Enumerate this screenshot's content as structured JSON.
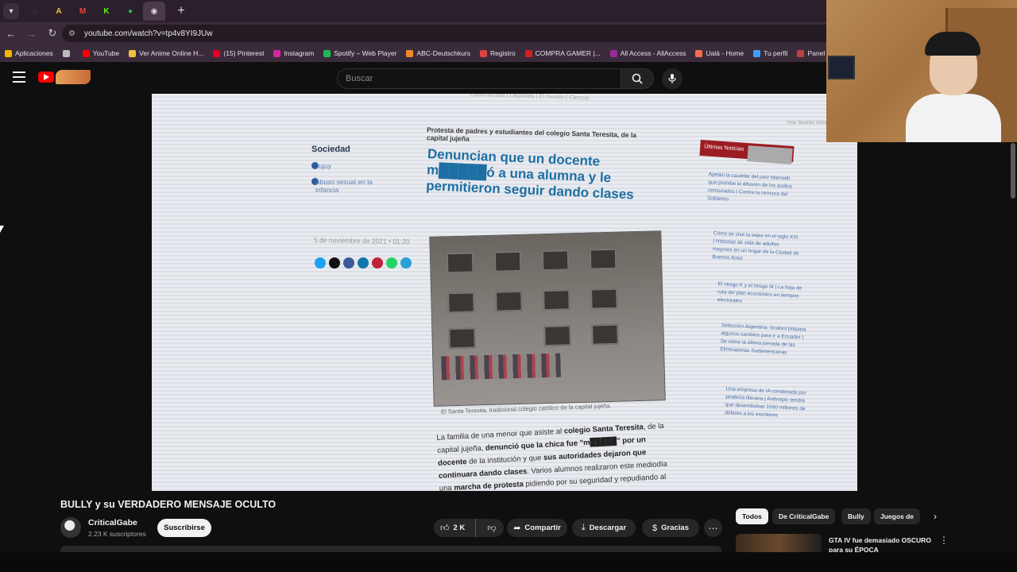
{
  "browser": {
    "tabs": [
      {
        "icon": "empty-tab-icon",
        "color": "#666666"
      },
      {
        "icon": "anime-tab-icon",
        "color": "#f0c040",
        "glyph": "A"
      },
      {
        "icon": "gmail-tab-icon",
        "color": "#ea4335",
        "glyph": "M"
      },
      {
        "icon": "kick-tab-icon",
        "color": "#53fc18",
        "glyph": "K"
      },
      {
        "icon": "spotify-tab-icon",
        "color": "#1db954",
        "glyph": "≡"
      },
      {
        "icon": "audio-tab-icon",
        "color": "#dddddd",
        "glyph": "◉",
        "active": true
      }
    ],
    "url": "youtube.com/watch?v=tp4v8YI9JUw",
    "bookmarks": [
      {
        "label": "Aplicaciones",
        "color": "#f4b400"
      },
      {
        "label": "",
        "color": "#bbbbbb"
      },
      {
        "label": "YouTube",
        "color": "#ff0000"
      },
      {
        "label": "Ver Anime Online H...",
        "color": "#f0c040"
      },
      {
        "label": "(15) Pinterest",
        "color": "#e60023"
      },
      {
        "label": "Instagram",
        "color": "#d6249f"
      },
      {
        "label": "Spotify – Web Player",
        "color": "#1db954"
      },
      {
        "label": "ABC-Deutschkurs",
        "color": "#f08a24"
      },
      {
        "label": "Registro",
        "color": "#e04040"
      },
      {
        "label": "COMPRA GAMER |...",
        "color": "#d02020"
      },
      {
        "label": "All Access - AllAccess",
        "color": "#9a2a9a"
      },
      {
        "label": "Ualá - Home",
        "color": "#ff6a4d"
      },
      {
        "label": "Tu perfil",
        "color": "#3aa0ff"
      },
      {
        "label": "Panel – academia",
        "color": "#c04040"
      }
    ]
  },
  "youtube": {
    "search_placeholder": "Buscar",
    "video": {
      "title": "BULLY y su VERDADERO MENSAJE OCULTO",
      "channel": "CriticalGabe",
      "subscribers": "2.23 K suscriptores",
      "subscribe_label": "Suscribirse",
      "likes": "2 K",
      "share_label": "Compartir",
      "download_label": "Descargar",
      "thanks_label": "Gracias"
    },
    "chips": [
      "Todos",
      "De CriticalGabe",
      "Bully",
      "Juegos de"
    ],
    "recommendation": {
      "title": "GTA IV fue demasiado OSCURO para su ÉPOCA"
    }
  },
  "article": {
    "top_nav": "Espectáculos  |  Deportes  |  El mundo  |  Ciencia",
    "date_top_right": "Hoy: Buenos Aires",
    "section": "Sociedad",
    "side_links": [
      "Jujuy",
      "Abuso sexual en la infancia"
    ],
    "kicker": "Protesta de padres y estudiantes del colegio Santa Teresita, de la capital jujeña",
    "headline": "Denuncian que un docente m█████ó a una alumna y le permitieron seguir dando clases",
    "date": "5 de noviembre de 2021 • 01:20",
    "caption": "El Santa Teresita, tradicional colegio católico de la capital jujeña.",
    "body_1": "La familia de una menor que asiste al ",
    "body_b1": "colegio Santa Teresita",
    "body_2": ", de la capital jujeña, ",
    "body_b2": "denunció que la chica fue \"m█████\" por un docente",
    "body_3": " de la institución y que ",
    "body_b3": "sus autoridades dejaron que continuara dando clases",
    "body_4": ". Varios alumnos realizaron este mediodía una ",
    "body_b4": "marcha de protesta",
    "body_5": " pidiendo por su seguridad y repudiando al",
    "badge": "Últimas Noticias",
    "right_links": [
      "Apelan la cautelar del juez Marinelli que prohíbe la difusión de los audios censurados | Contra la censura del Gobierno",
      "Cómo se vive la vejez en el siglo XXI | Historias de vida de adultos mayores en un hogar de la Ciudad de Buenos Aires",
      "El riesgo K y el riesgo M | La hoja de ruta del plan económico en tiempos electorales",
      "Selección Argentina: Scaloni prepara algunos cambios para ir a Ecuador | Se viene la última jornada de las Eliminatorias Sudamericanas",
      "Una empresa de IA condenada por piratería literaria | Anthropic tendrá que desembolsar 1500 millones de dólares a los escritores"
    ]
  }
}
